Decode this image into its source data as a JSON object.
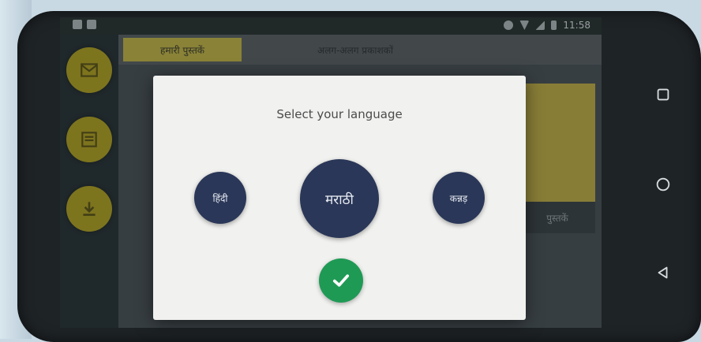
{
  "status_bar": {
    "left_icons": [
      "music-icon",
      "image-icon"
    ],
    "right_icons": [
      "alarm-icon",
      "wifi-icon",
      "signal-icon",
      "battery-icon"
    ],
    "time": "11:58"
  },
  "sidebar": {
    "buttons": [
      {
        "icon": "mail-icon"
      },
      {
        "icon": "book-icon"
      },
      {
        "icon": "download-icon"
      }
    ]
  },
  "tabs": [
    "हमारी पुस्तकें",
    "अलग-अलग प्रकाशकों"
  ],
  "card": {
    "caption": "पुस्तकें"
  },
  "dialog": {
    "title": "Select your language",
    "languages": [
      {
        "label": "हिंदी",
        "size": "small"
      },
      {
        "label": "मराठी",
        "size": "big",
        "selected": true
      },
      {
        "label": "कन्नड़",
        "size": "small"
      }
    ],
    "confirm_icon": "check-icon"
  },
  "navigation": [
    "recent-apps-icon",
    "home-icon",
    "back-icon"
  ],
  "colors": {
    "language_button": "#2a3758",
    "confirm_button": "#1f9a55",
    "sidebar_button": "#b5a51f",
    "dialog_background": "#f1f1ef"
  }
}
